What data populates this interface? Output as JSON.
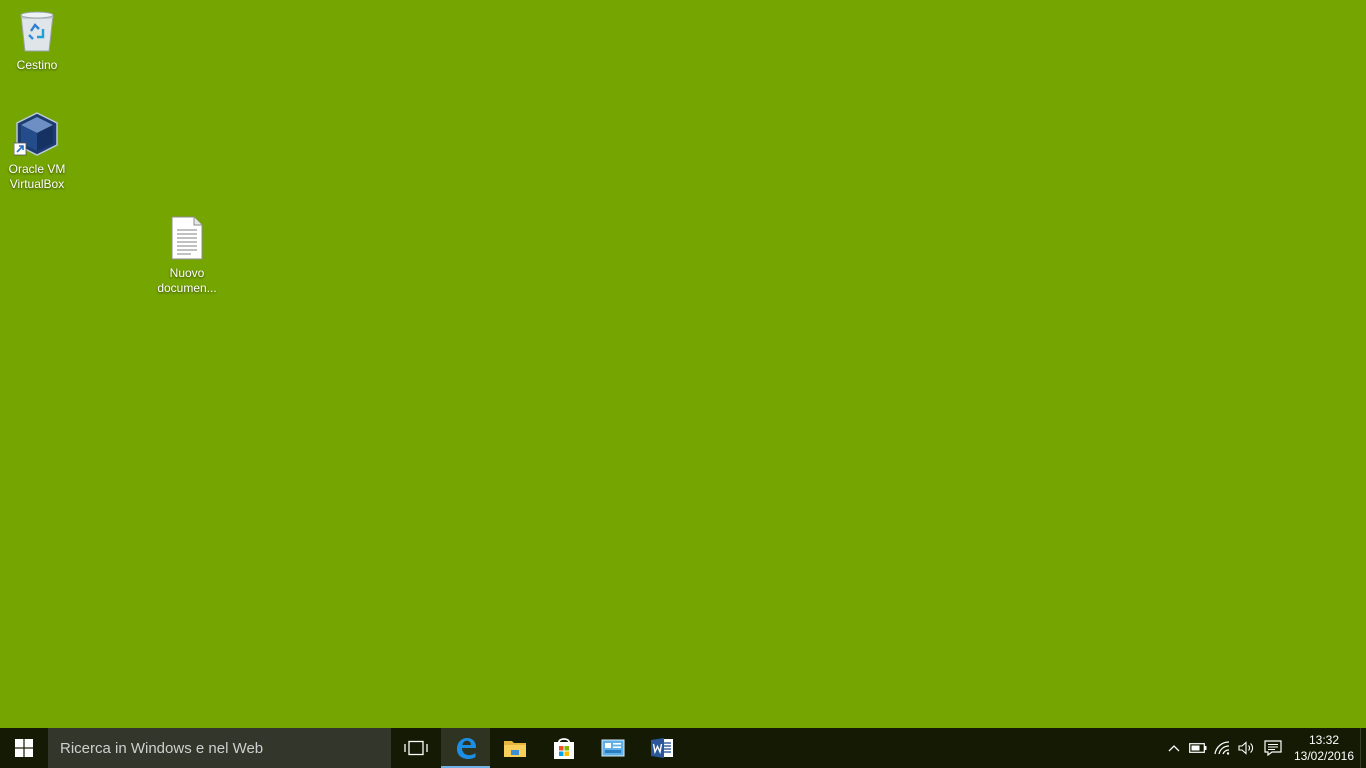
{
  "desktop": {
    "background_color": "#74a500",
    "icons": [
      {
        "label": "Cestino",
        "icon": "recycle-bin-icon"
      },
      {
        "label": "Oracle VM VirtualBox",
        "icon": "virtualbox-icon"
      },
      {
        "label": "Nuovo documen...",
        "icon": "text-document-icon"
      }
    ]
  },
  "taskbar": {
    "background_color": "#141a04",
    "search_placeholder": "Ricerca in Windows e nel Web",
    "pinned_apps": [
      {
        "name": "Microsoft Edge",
        "icon": "edge-icon",
        "active": true
      },
      {
        "name": "Esplora file",
        "icon": "file-explorer-icon",
        "active": false
      },
      {
        "name": "Store",
        "icon": "store-icon",
        "active": false
      },
      {
        "name": "Pannello di controllo",
        "icon": "control-panel-icon",
        "active": false
      },
      {
        "name": "Word",
        "icon": "word-icon",
        "active": false
      }
    ],
    "tray": {
      "icons": [
        "chevron-up-icon",
        "battery-icon",
        "wifi-icon",
        "volume-icon",
        "action-center-icon"
      ]
    },
    "clock": {
      "time": "13:32",
      "date": "13/02/2016"
    }
  }
}
